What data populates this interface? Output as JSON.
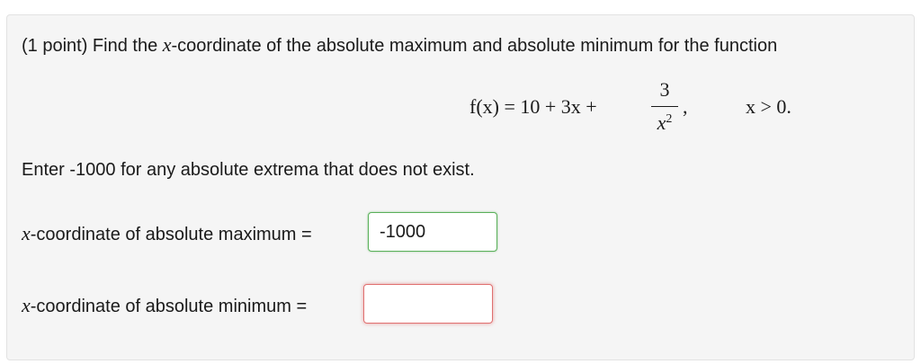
{
  "problem": {
    "intro_prefix": "(1 point) Find the ",
    "intro_var": "x",
    "intro_suffix": "-coordinate of the absolute maximum and absolute minimum for the function",
    "equation": {
      "lhs": "f(x) = 10 + 3x +",
      "fraction_numerator": "3",
      "fraction_denominator_base": "x",
      "fraction_denominator_exponent": "2",
      "comma": ",",
      "domain": "x > 0."
    },
    "instruction": "Enter -1000 for any absolute extrema that does not exist.",
    "answers": [
      {
        "label_var": "x",
        "label_text": "-coordinate of absolute maximum =",
        "value": "-1000",
        "status": "correct",
        "border_color": "#5ab05a"
      },
      {
        "label_var": "x",
        "label_text": "-coordinate of absolute minimum =",
        "value": "",
        "status": "incorrect",
        "border_color": "#e07070"
      }
    ]
  },
  "colors": {
    "card_background": "#f5f5f5",
    "correct_border": "#5ab05a",
    "incorrect_border": "#e07070"
  }
}
